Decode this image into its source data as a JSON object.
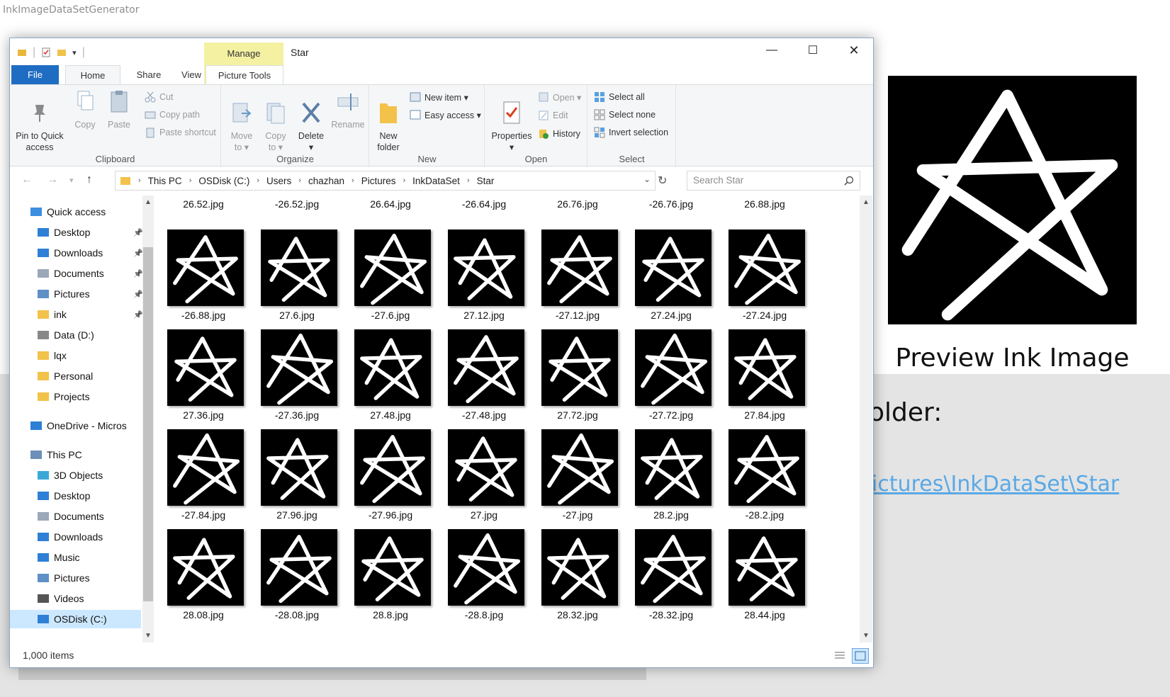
{
  "host": {
    "title": "InkImageDataSetGenerator",
    "preview_label": "Preview Ink Image",
    "folder_label": "older:",
    "folder_link": "ictures\\InkDataSet\\Star"
  },
  "window": {
    "title": "Star",
    "manage_label": "Manage",
    "tabs": {
      "file": "File",
      "home": "Home",
      "share": "Share",
      "view": "View",
      "picture_tools": "Picture Tools"
    },
    "help": "?",
    "controls": {
      "minimize": "—",
      "maximize": "☐",
      "close": "✕"
    }
  },
  "ribbon": {
    "clipboard": {
      "label": "Clipboard",
      "pin": "Pin to Quick\naccess",
      "copy": "Copy",
      "paste": "Paste",
      "cut": "Cut",
      "copy_path": "Copy path",
      "paste_shortcut": "Paste shortcut"
    },
    "organize": {
      "label": "Organize",
      "move_to": "Move\nto ▾",
      "copy_to": "Copy\nto ▾",
      "delete": "Delete\n▾",
      "rename": "Rename"
    },
    "new": {
      "label": "New",
      "new_folder": "New\nfolder",
      "new_item": "New item ▾",
      "easy_access": "Easy access ▾"
    },
    "open": {
      "label": "Open",
      "properties": "Properties\n▾",
      "open": "Open ▾",
      "edit": "Edit",
      "history": "History"
    },
    "select": {
      "label": "Select",
      "select_all": "Select all",
      "select_none": "Select none",
      "invert_selection": "Invert selection"
    }
  },
  "address": {
    "crumbs": [
      "This PC",
      "OSDisk (C:)",
      "Users",
      "chazhan",
      "Pictures",
      "InkDataSet",
      "Star"
    ],
    "search_placeholder": "Search Star"
  },
  "nav": {
    "items": [
      {
        "label": "Quick access",
        "icon": "star-icon",
        "pinned": false,
        "indent": 1,
        "selected": false
      },
      {
        "label": "Desktop",
        "icon": "desktop-icon",
        "pinned": true,
        "indent": 2,
        "selected": false
      },
      {
        "label": "Downloads",
        "icon": "download-icon",
        "pinned": true,
        "indent": 2,
        "selected": false
      },
      {
        "label": "Documents",
        "icon": "documents-icon",
        "pinned": true,
        "indent": 2,
        "selected": false
      },
      {
        "label": "Pictures",
        "icon": "pictures-icon",
        "pinned": true,
        "indent": 2,
        "selected": false
      },
      {
        "label": "ink",
        "icon": "folder-icon",
        "pinned": true,
        "indent": 2,
        "selected": false
      },
      {
        "label": "Data (D:)",
        "icon": "drive-icon",
        "pinned": false,
        "indent": 2,
        "selected": false
      },
      {
        "label": "lqx",
        "icon": "folder-icon",
        "pinned": false,
        "indent": 2,
        "selected": false
      },
      {
        "label": "Personal",
        "icon": "folder-icon",
        "pinned": false,
        "indent": 2,
        "selected": false
      },
      {
        "label": "Projects",
        "icon": "folder-icon",
        "pinned": false,
        "indent": 2,
        "selected": false
      },
      {
        "label": "OneDrive - Micros",
        "icon": "cloud-icon",
        "pinned": false,
        "indent": 1,
        "selected": false
      },
      {
        "label": "This PC",
        "icon": "computer-icon",
        "pinned": false,
        "indent": 1,
        "selected": false
      },
      {
        "label": "3D Objects",
        "icon": "3d-objects-icon",
        "pinned": false,
        "indent": 2,
        "selected": false
      },
      {
        "label": "Desktop",
        "icon": "desktop-icon",
        "pinned": false,
        "indent": 2,
        "selected": false
      },
      {
        "label": "Documents",
        "icon": "documents-icon",
        "pinned": false,
        "indent": 2,
        "selected": false
      },
      {
        "label": "Downloads",
        "icon": "download-icon",
        "pinned": false,
        "indent": 2,
        "selected": false
      },
      {
        "label": "Music",
        "icon": "music-icon",
        "pinned": false,
        "indent": 2,
        "selected": false
      },
      {
        "label": "Pictures",
        "icon": "pictures-icon",
        "pinned": false,
        "indent": 2,
        "selected": false
      },
      {
        "label": "Videos",
        "icon": "videos-icon",
        "pinned": false,
        "indent": 2,
        "selected": false
      },
      {
        "label": "OSDisk (C:)",
        "icon": "windows-drive-icon",
        "pinned": false,
        "indent": 2,
        "selected": true
      }
    ]
  },
  "files": {
    "top_partial": [
      "26.52.jpg",
      "-26.52.jpg",
      "26.64.jpg",
      "-26.64.jpg",
      "26.76.jpg",
      "-26.76.jpg",
      "26.88.jpg"
    ],
    "rows": [
      [
        "-26.88.jpg",
        "27.6.jpg",
        "-27.6.jpg",
        "27.12.jpg",
        "-27.12.jpg",
        "27.24.jpg",
        "-27.24.jpg"
      ],
      [
        "27.36.jpg",
        "-27.36.jpg",
        "27.48.jpg",
        "-27.48.jpg",
        "27.72.jpg",
        "-27.72.jpg",
        "27.84.jpg"
      ],
      [
        "-27.84.jpg",
        "27.96.jpg",
        "-27.96.jpg",
        "27.jpg",
        "-27.jpg",
        "28.2.jpg",
        "-28.2.jpg"
      ],
      [
        "28.08.jpg",
        "-28.08.jpg",
        "28.8.jpg",
        "-28.8.jpg",
        "28.32.jpg",
        "-28.32.jpg",
        "28.44.jpg"
      ]
    ]
  },
  "status": {
    "item_count": "1,000 items"
  },
  "colors": {
    "accent": "#1f6dc2",
    "manage_tab": "#f4f1a2",
    "selection": "#cce8ff",
    "link": "#5aa9e6"
  }
}
